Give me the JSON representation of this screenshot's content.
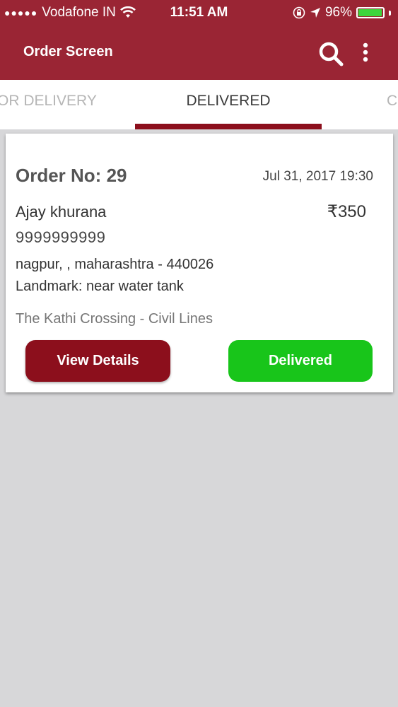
{
  "status_bar": {
    "signal_dots": "●●●●●",
    "carrier": "Vodafone IN",
    "time": "11:51 AM",
    "battery_percent": "96%",
    "battery_level": 0.96,
    "icons": [
      "wifi-icon",
      "orientation-lock-icon",
      "location-arrow-icon",
      "battery-icon"
    ]
  },
  "app_bar": {
    "title": "Order Screen",
    "icons": [
      "search-icon",
      "more-vertical-icon"
    ]
  },
  "tabs": [
    {
      "label": "OR DELIVERY",
      "active": false
    },
    {
      "label": "DELIVERED",
      "active": true
    },
    {
      "label": "C",
      "active": false
    }
  ],
  "order": {
    "order_no": "Order No: 29",
    "date": "Jul 31, 2017 19:30",
    "customer_name": "Ajay khurana",
    "amount": "₹350",
    "phone": "9999999999",
    "address": "nagpur, , maharashtra - 440026",
    "landmark": "Landmark: near water tank",
    "restaurant": "The Kathi Crossing - Civil Lines",
    "view_details_label": "View Details",
    "delivered_label": "Delivered"
  },
  "colors": {
    "header": "#9a2534",
    "tab_indicator": "#8c0f1c",
    "view_details_button": "#8c0f1c",
    "delivered_button": "#18c51a",
    "background": "#d7d7d9"
  }
}
